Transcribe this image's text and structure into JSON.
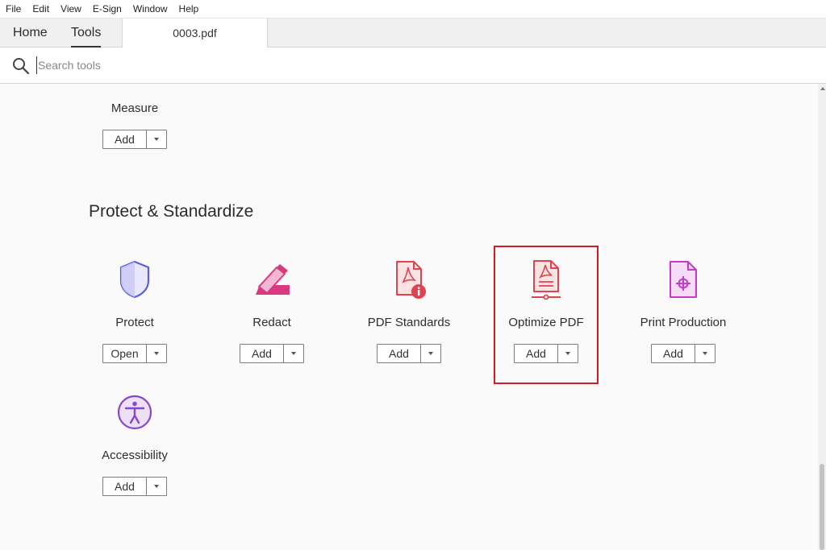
{
  "menubar": {
    "items": [
      "File",
      "Edit",
      "View",
      "E-Sign",
      "Window",
      "Help"
    ]
  },
  "tabs": {
    "home": "Home",
    "tools": "Tools",
    "document": "0003.pdf"
  },
  "search": {
    "placeholder": "Search tools",
    "value": ""
  },
  "measure": {
    "label": "Measure",
    "button": "Add"
  },
  "section": {
    "title": "Protect & Standardize"
  },
  "tools": [
    {
      "label": "Protect",
      "button": "Open",
      "icon": "shield-icon",
      "color": "#5a5fd6"
    },
    {
      "label": "Redact",
      "button": "Add",
      "icon": "redact-marker-icon",
      "color": "#d8397f"
    },
    {
      "label": "PDF Standards",
      "button": "Add",
      "icon": "pdf-standards-icon",
      "color": "#e0434f"
    },
    {
      "label": "Optimize PDF",
      "button": "Add",
      "icon": "optimize-pdf-icon",
      "color": "#e0434f"
    },
    {
      "label": "Print Production",
      "button": "Add",
      "icon": "print-production-icon",
      "color": "#c43cc6"
    },
    {
      "label": "Accessibility",
      "button": "Add",
      "icon": "accessibility-icon",
      "color": "#8a47c8"
    }
  ],
  "highlight_color": "#d01e1e"
}
